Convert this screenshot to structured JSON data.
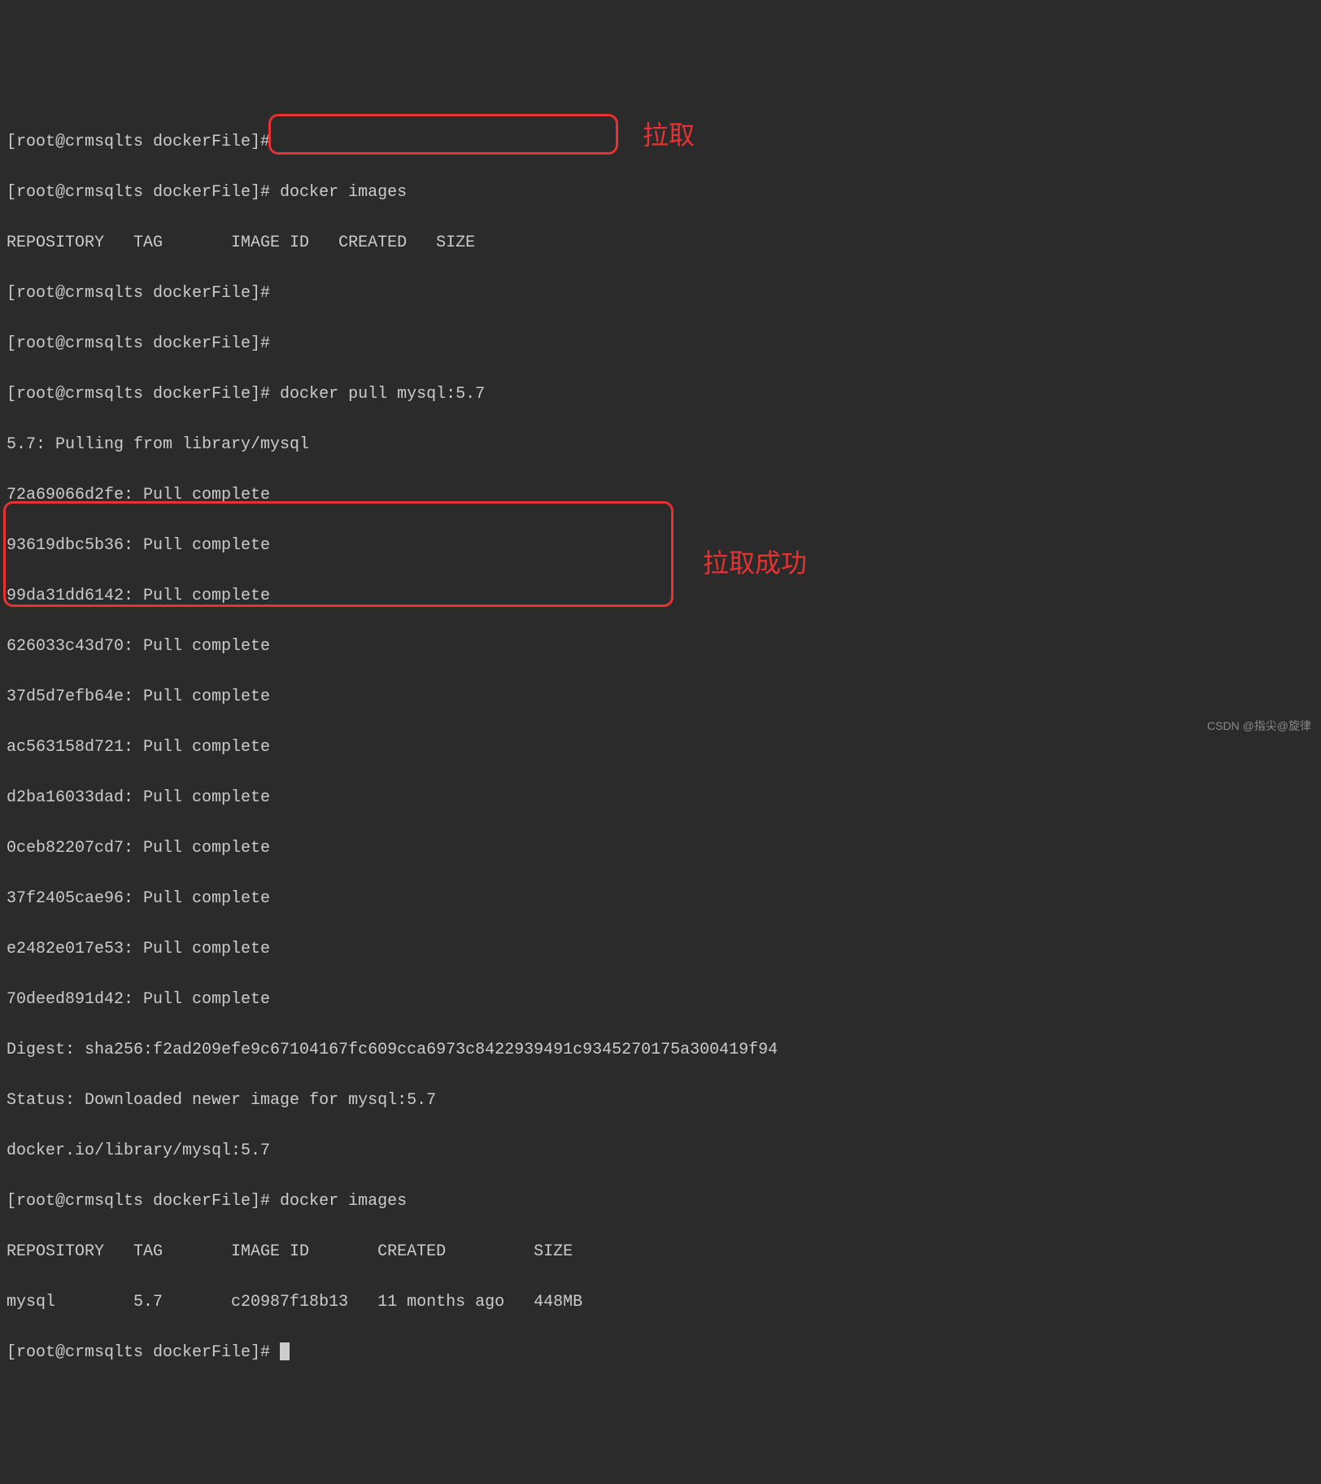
{
  "prompt": "[root@crmsqlts dockerFile]# ",
  "lines": {
    "l0": "[root@crmsqlts dockerFile]# ",
    "l1": "[root@crmsqlts dockerFile]# docker images",
    "l2": "REPOSITORY   TAG       IMAGE ID   CREATED   SIZE",
    "l3": "[root@crmsqlts dockerFile]# ",
    "l4": "[root@crmsqlts dockerFile]# ",
    "l5": "[root@crmsqlts dockerFile]# docker pull mysql:5.7",
    "l6": "5.7: Pulling from library/mysql",
    "l7": "72a69066d2fe: Pull complete",
    "l8": "93619dbc5b36: Pull complete",
    "l9": "99da31dd6142: Pull complete",
    "l10": "626033c43d70: Pull complete",
    "l11": "37d5d7efb64e: Pull complete",
    "l12": "ac563158d721: Pull complete",
    "l13": "d2ba16033dad: Pull complete",
    "l14": "0ceb82207cd7: Pull complete",
    "l15": "37f2405cae96: Pull complete",
    "l16": "e2482e017e53: Pull complete",
    "l17": "70deed891d42: Pull complete",
    "l18": "Digest: sha256:f2ad209efe9c67104167fc609cca6973c8422939491c9345270175a300419f94",
    "l19": "Status: Downloaded newer image for mysql:5.7",
    "l20": "docker.io/library/mysql:5.7",
    "l21": "[root@crmsqlts dockerFile]# docker images",
    "l22": "REPOSITORY   TAG       IMAGE ID       CREATED         SIZE",
    "l23": "mysql        5.7       c20987f18b13   11 months ago   448MB",
    "l24": "[root@crmsqlts dockerFile]# "
  },
  "annotations": {
    "label1": "拉取",
    "label2": "拉取成功"
  },
  "watermark": "CSDN @指尖@旋律"
}
